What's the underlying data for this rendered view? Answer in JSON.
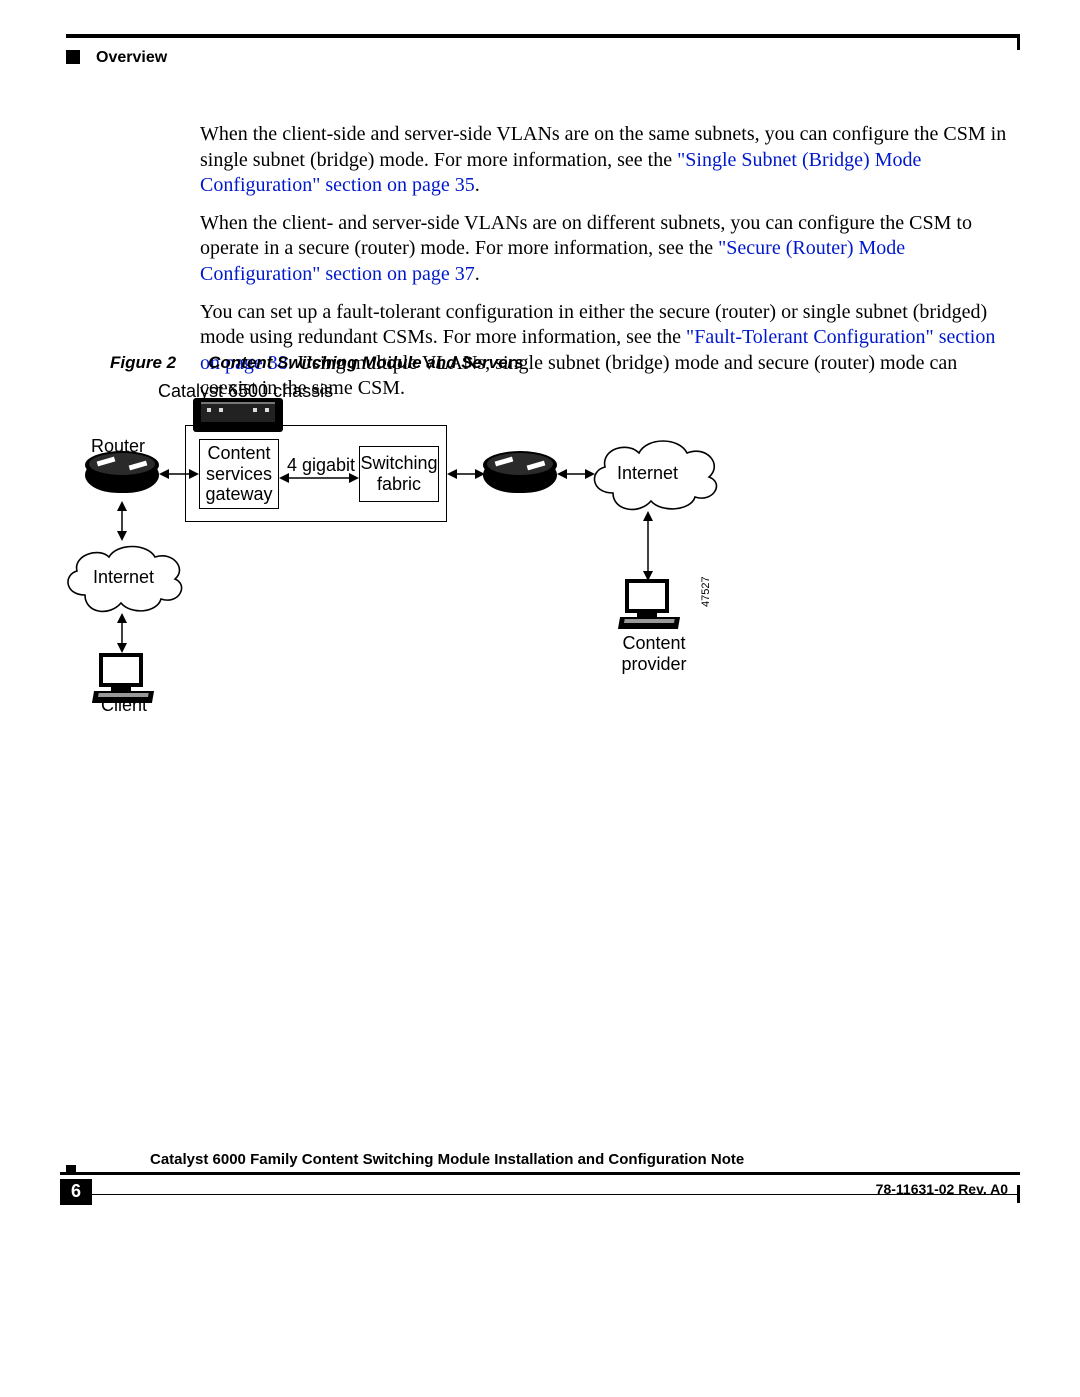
{
  "header": {
    "section": "Overview"
  },
  "paragraphs": {
    "p1a": "When the client-side and server-side VLANs are on the same subnets, you can configure the CSM in single subnet (bridge) mode. For more information, see the ",
    "p1link": "\"Single Subnet (Bridge) Mode Configuration\" section on page 35",
    "p1b": ".",
    "p2a": "When the client- and server-side VLANs are on different subnets, you can configure the CSM to operate in a secure (router) mode. For more information, see the ",
    "p2link": "\"Secure (Router) Mode Configuration\" section on page 37",
    "p2b": ".",
    "p3a": "You can set up a fault-tolerant configuration in either the secure (router) or single subnet (bridged) mode using redundant CSMs. For more information, see the ",
    "p3link": "\"Fault-Tolerant Configuration\" section on page 38",
    "p3b": ". Using multiple VLANs, single subnet (bridge) mode and secure (router) mode can coexist in the same CSM."
  },
  "figure": {
    "label": "Figure 2",
    "title": "Content Switching Module and Servers",
    "id": "47527",
    "labels": {
      "chassis": "Catalyst 6500 chassis",
      "router": "Router",
      "csg": "Content\nservices\ngateway",
      "link": "4 gigabit",
      "fabric": "Switching\nfabric",
      "internet1": "Internet",
      "internet2": "Internet",
      "client": "Client",
      "provider": "Content\nprovider"
    }
  },
  "footer": {
    "doc_title": "Catalyst 6000 Family Content Switching Module Installation and Configuration Note",
    "page": "6",
    "rev": "78-11631-02 Rev. A0"
  }
}
